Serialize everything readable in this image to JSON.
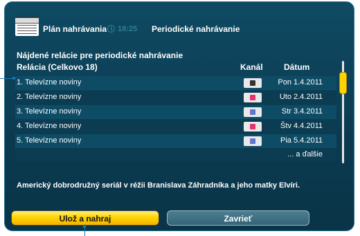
{
  "header": {
    "title": "Plán nahrávania",
    "time": "18:25",
    "subtitle": "Periodické nahrávanie",
    "icons": [
      "calendar-icon",
      "clock-icon"
    ]
  },
  "table": {
    "caption": "Nájdené relácie pre periodické nahrávanie",
    "columns": {
      "relacia": "Relácia  (Celkovo 18)",
      "kanal": "Kanál",
      "datum": "Dátum"
    },
    "rows": [
      {
        "relacia": "1. Televízne noviny",
        "kanal": "channel-logo-dark",
        "datum": "Pon 1.4.2011"
      },
      {
        "relacia": "2. Televízne noviny",
        "kanal": "channel-logo-red",
        "datum": "Uto 2.4.2011"
      },
      {
        "relacia": "3. Televízne noviny",
        "kanal": "channel-logo-multi",
        "datum": "Str 3.4.2011"
      },
      {
        "relacia": "4. Televízne noviny",
        "kanal": "channel-logo-red",
        "datum": "Štv 4.4.2011"
      },
      {
        "relacia": "5. Televízne noviny",
        "kanal": "channel-logo-multi",
        "datum": "Pia 5.4.2011"
      }
    ],
    "more": "... a ďalšie"
  },
  "description": "Americký dobrodružný seriál v réžii Branislava Záhradníka a jeho matky Elvíri.",
  "buttons": {
    "save": "Ulož a nahraj",
    "close": "Zavrieť"
  },
  "colors": {
    "panel_bg": "#0b3a50",
    "accent_yellow": "#ffd200",
    "muted_teal": "#2f7f92"
  }
}
